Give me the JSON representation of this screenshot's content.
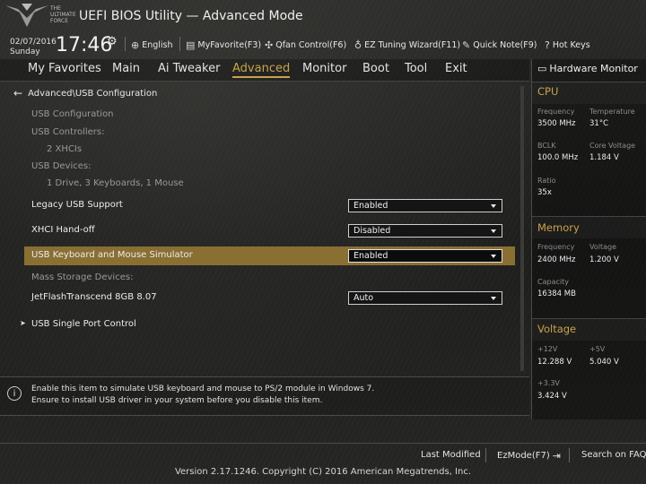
{
  "header": {
    "logo_text": "THE ULTIMATE FORCE",
    "title": "UEFI BIOS Utility — Advanced Mode",
    "date": "02/07/2016",
    "day": "Sunday",
    "time": "17:46",
    "buttons": [
      {
        "label": "English"
      },
      {
        "label": "MyFavorite(F3)"
      },
      {
        "label": "Qfan Control(F6)"
      },
      {
        "label": "EZ Tuning Wizard(F11)"
      },
      {
        "label": "Quick Note(F9)"
      },
      {
        "label": "Hot Keys"
      }
    ]
  },
  "tabs": [
    {
      "label": "My Favorites"
    },
    {
      "label": "Main"
    },
    {
      "label": "Ai Tweaker"
    },
    {
      "label": "Advanced"
    },
    {
      "label": "Monitor"
    },
    {
      "label": "Boot"
    },
    {
      "label": "Tool"
    },
    {
      "label": "Exit"
    }
  ],
  "main": {
    "breadcrumb": "Advanced\\USB Configuration",
    "usb_configuration": "USB Configuration",
    "usb_controllers_label": "USB Controllers:",
    "usb_controllers_value": "2 XHCIs",
    "usb_devices_label": "USB Devices:",
    "usb_devices_value": "1 Drive, 3 Keyboards, 1 Mouse",
    "settings": [
      {
        "label": "Legacy USB Support",
        "value": "Enabled"
      },
      {
        "label": "XHCI Hand-off",
        "value": "Disabled"
      },
      {
        "label": "USB Keyboard and Mouse Simulator",
        "value": "Enabled"
      }
    ],
    "mass_storage_label": "Mass Storage Devices:",
    "mass_storage_device": {
      "label": "JetFlashTranscend 8GB 8.07",
      "value": "Auto"
    },
    "single_port_control": "USB Single Port Control"
  },
  "help": {
    "line1": "Enable this item to simulate USB keyboard and mouse to PS/2 module in Windows 7.",
    "line2": "Ensure to install USB driver in your system before you disable this item."
  },
  "hardware_monitor": {
    "title": "Hardware Monitor",
    "cpu": {
      "title": "CPU",
      "frequency_label": "Frequency",
      "frequency": "3500 MHz",
      "temperature_label": "Temperature",
      "temperature": "31°C",
      "bclk_label": "BCLK",
      "bclk": "100.0 MHz",
      "core_voltage_label": "Core Voltage",
      "core_voltage": "1.184 V",
      "ratio_label": "Ratio",
      "ratio": "35x"
    },
    "memory": {
      "title": "Memory",
      "frequency_label": "Frequency",
      "frequency": "2400 MHz",
      "voltage_label": "Voltage",
      "voltage": "1.200 V",
      "capacity_label": "Capacity",
      "capacity": "16384 MB"
    },
    "voltage": {
      "title": "Voltage",
      "v12_label": "+12V",
      "v12": "12.288 V",
      "v5_label": "+5V",
      "v5": "5.040 V",
      "v33_label": "+3.3V",
      "v33": "3.424 V"
    }
  },
  "footer": {
    "last_modified": "Last Modified",
    "ezmode": "EzMode(F7)",
    "search_faq": "Search on FAQ",
    "version": "Version 2.17.1246. Copyright (C) 2016 American Megatrends, Inc."
  },
  "colors": {
    "accent": "#c9a34e",
    "highlight": "#8a6f33"
  }
}
